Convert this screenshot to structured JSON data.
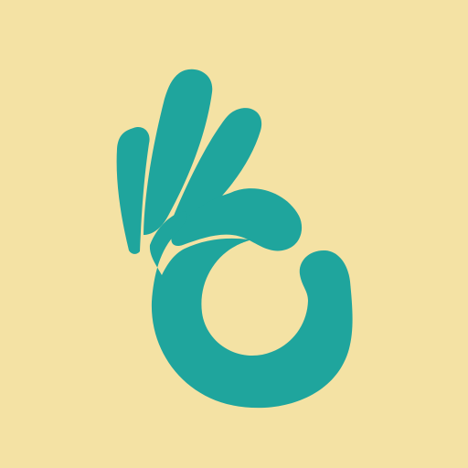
{
  "icon": {
    "name": "ok-hand-icon",
    "background_color": "#F4E2A4",
    "foreground_color": "#1FA59D"
  }
}
